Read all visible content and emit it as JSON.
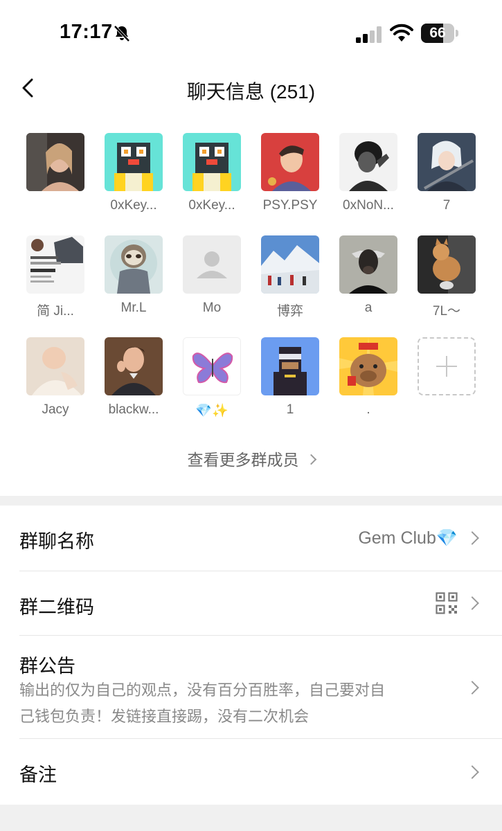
{
  "status_bar": {
    "time": "17:17",
    "battery_level": "66",
    "battery_fraction": 0.66
  },
  "nav": {
    "title": "聊天信息 (251)"
  },
  "members": [
    {
      "name": "",
      "avatar": "woman-portrait"
    },
    {
      "name": "0xKey...",
      "avatar": "pixel-penguin"
    },
    {
      "name": "0xKey...",
      "avatar": "pixel-penguin"
    },
    {
      "name": "PSY.PSY",
      "avatar": "anime-boy-red"
    },
    {
      "name": "0xNoN...",
      "avatar": "bw-portrait"
    },
    {
      "name": "7",
      "avatar": "anime-girl-white-hair"
    },
    {
      "name": "简 Ji...",
      "avatar": "house-flyer"
    },
    {
      "name": "Mr.L",
      "avatar": "sloth"
    },
    {
      "name": "Mo",
      "avatar": "default-user"
    },
    {
      "name": "博弈",
      "avatar": "snow-mountain"
    },
    {
      "name": "a",
      "avatar": "cow-head"
    },
    {
      "name": "7L～",
      "avatar": "cat"
    },
    {
      "name": "Jacy",
      "avatar": "baby"
    },
    {
      "name": "blackw...",
      "avatar": "man-surprised"
    },
    {
      "name": "💎✨",
      "avatar": "butterfly"
    },
    {
      "name": "1",
      "avatar": "pixel-character"
    },
    {
      "name": ".",
      "avatar": "capybara"
    },
    {
      "name": "",
      "avatar": "add-member"
    }
  ],
  "more_members_label": "查看更多群成员",
  "settings": {
    "group_name": {
      "label": "群聊名称",
      "value": "Gem Club💎"
    },
    "qr_code": {
      "label": "群二维码"
    },
    "announcement": {
      "label": "群公告",
      "text_line1": "输出的仅为自己的观点，没有百分百胜率，自己要对自",
      "text_line2": "己钱包负责！发链接直接踢，没有二次机会"
    },
    "remark": {
      "label": "备注"
    }
  }
}
